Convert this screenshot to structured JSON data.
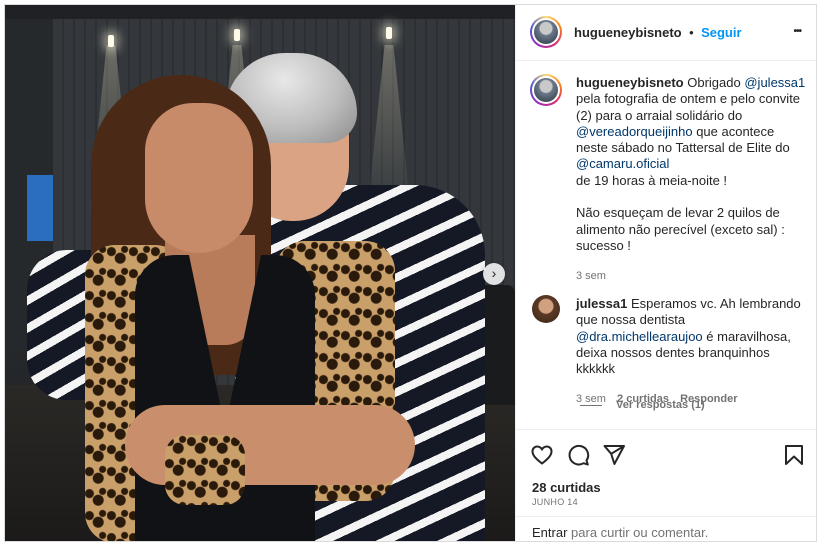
{
  "post": {
    "author": "hugueneybisneto",
    "separator": "•",
    "follow_label": "Seguir",
    "more_label": "•••",
    "caption": {
      "author": "hugueneybisneto",
      "text_1": "Obrigado",
      "mention_1": "@julessa1",
      "text_2": "pela fotografia de ontem e pelo convite (2) para o arraial solidário do",
      "mention_2": "@vereadorqueijinho",
      "text_3": "que acontece neste sábado no Tattersal de Elite do",
      "mention_3": "@camaru.oficial",
      "text_4": "de 19 horas à meia-noite !",
      "text_5": "Não esqueçam de levar 2 quilos de alimento não perecível (exceto sal) : sucesso !",
      "time": "3 sem"
    },
    "comment": {
      "author": "julessa1",
      "text_1": "Esperamos vc. Ah lembrando que nossa dentista",
      "mention": "@dra.michellearaujoo",
      "text_2": "é maravilhosa, deixa nossos dentes branquinhos kkkkkk",
      "time": "3 sem",
      "likes": "2 curtidas",
      "reply_label": "Responder",
      "view_replies": "Ver respostas (1)"
    },
    "likes_label": "28 curtidas",
    "date": "JUNHO 14",
    "login": {
      "link": "Entrar",
      "text": "para curtir ou comentar."
    }
  },
  "photo": {
    "next_arrow": "›"
  },
  "icons": {
    "like": "heart-icon",
    "comment": "comment-icon",
    "share": "send-icon",
    "save": "bookmark-icon"
  },
  "colors": {
    "follow": "#0095f6",
    "mention": "#00376b",
    "muted": "#737373"
  }
}
